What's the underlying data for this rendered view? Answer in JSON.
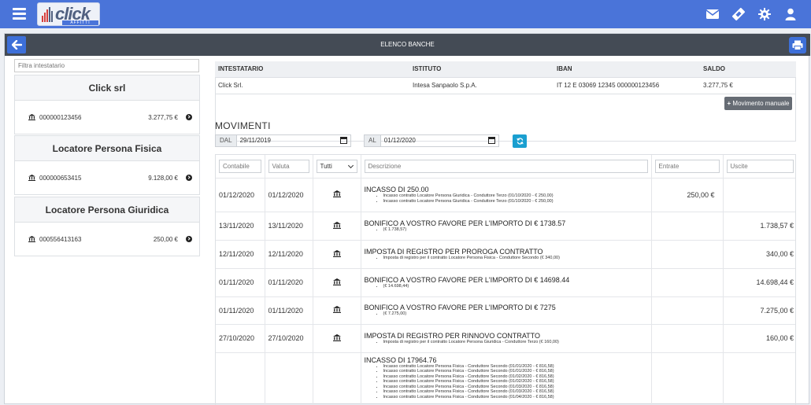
{
  "app": {
    "logo_text": "click",
    "logo_sub": "AFFITTI"
  },
  "panel": {
    "title": "ELENCO BANCHE"
  },
  "sidebar": {
    "filter_placeholder": "Filtra intestatario",
    "groups": [
      {
        "name": "Click srl",
        "account": "000000123456",
        "balance": "3.277,75 €"
      },
      {
        "name": "Locatore Persona Fisica",
        "account": "000000653415",
        "balance": "9.128,00 €"
      },
      {
        "name": "Locatore Persona Giuridica",
        "account": "000556413163",
        "balance": "250,00 €"
      }
    ]
  },
  "account_table": {
    "headers": [
      "INTESTATARIO",
      "ISTITUTO",
      "IBAN",
      "SALDO"
    ],
    "row": [
      "Click Srl.",
      "Intesa Sanpaolo S.p.A.",
      "IT 12 E 03069 12345 000000123456",
      "3.277,75 €"
    ],
    "manual_button": "Movimento manuale"
  },
  "movements": {
    "title": "MOVIMENTI",
    "from_label": "DAL",
    "from_value": "29/11/2019",
    "to_label": "AL",
    "to_value": "01/12/2020",
    "filters": {
      "contabile": "Contabile",
      "valuta": "Valuta",
      "tipo": "Tutti",
      "descrizione": "Descrizione",
      "entrate": "Entrate",
      "uscite": "Uscite"
    },
    "rows": [
      {
        "contabile": "01/12/2020",
        "valuta": "01/12/2020",
        "title": "INCASSO DI 250.00",
        "details": [
          "Incasso contratto Locatore Persona Giuridica - Conduttore Terzo (01/10/2020 - € 250,00)",
          "Incasso contratto Locatore Persona Giuridica - Conduttore Terzo (01/10/2020 - € 250,00)"
        ],
        "entrate": "250,00 €",
        "uscite": ""
      },
      {
        "contabile": "13/11/2020",
        "valuta": "13/11/2020",
        "title": "BONIFICO A VOSTRO FAVORE PER L'IMPORTO DI € 1738.57",
        "details": [
          "(€ 1.738,57)"
        ],
        "entrate": "",
        "uscite": "1.738,57 €"
      },
      {
        "contabile": "12/11/2020",
        "valuta": "12/11/2020",
        "title": "IMPOSTA DI REGISTRO PER PROROGA CONTRATTO",
        "details": [
          "Imposta di registro per il contratto Locatore Persona Fisica - Conduttore Secondo (€ 340,00)"
        ],
        "entrate": "",
        "uscite": "340,00 €"
      },
      {
        "contabile": "01/11/2020",
        "valuta": "01/11/2020",
        "title": "BONIFICO A VOSTRO FAVORE PER L'IMPORTO DI € 14698.44",
        "details": [
          "(€ 14.698,44)"
        ],
        "entrate": "",
        "uscite": "14.698,44 €"
      },
      {
        "contabile": "01/11/2020",
        "valuta": "01/11/2020",
        "title": "BONIFICO A VOSTRO FAVORE PER L'IMPORTO DI € 7275",
        "details": [
          "(€ 7.275,00)"
        ],
        "entrate": "",
        "uscite": "7.275,00 €"
      },
      {
        "contabile": "27/10/2020",
        "valuta": "27/10/2020",
        "title": "IMPOSTA DI REGISTRO PER RINNOVO CONTRATTO",
        "details": [
          "Imposta di registro per il contratto Locatore Persona Giuridica - Conduttore Terzo (€ 160,00)"
        ],
        "entrate": "",
        "uscite": "160,00 €"
      },
      {
        "contabile": "",
        "valuta": "",
        "title": "INCASSO DI 17964.76",
        "details": [
          "Incasso contratto Locatore Persona Fisica - Conduttore Secondo (01/01/2020 - € 816,58)",
          "Incasso contratto Locatore Persona Fisica - Conduttore Secondo (01/01/2020 - € 816,58)",
          "Incasso contratto Locatore Persona Fisica - Conduttore Secondo (01/02/2020 - € 816,58)",
          "Incasso contratto Locatore Persona Fisica - Conduttore Secondo (01/02/2020 - € 816,58)",
          "Incasso contratto Locatore Persona Fisica - Conduttore Secondo (01/03/2020 - € 816,58)",
          "Incasso contratto Locatore Persona Fisica - Conduttore Secondo (01/03/2020 - € 816,58)",
          "Incasso contratto Locatore Persona Fisica - Conduttore Secondo (01/04/2020 - € 816,58)"
        ],
        "entrate": "",
        "uscite": ""
      }
    ]
  },
  "colors": {
    "topbar": "#4a74d9",
    "panel_header": "#444b55",
    "primary_button": "#3d6fd8",
    "refresh_button": "#1a9fd0",
    "secondary_button": "#666c74"
  },
  "icons": {
    "menu": "hamburger-icon",
    "mail": "envelope-icon",
    "tickets": "ticket-icon",
    "settings": "gear-icon",
    "user": "user-icon",
    "back": "arrow-left-icon",
    "print": "printer-icon",
    "bank": "bank-icon",
    "refresh": "refresh-icon",
    "calendar": "calendar-icon",
    "go": "chevron-circle-right-icon"
  }
}
